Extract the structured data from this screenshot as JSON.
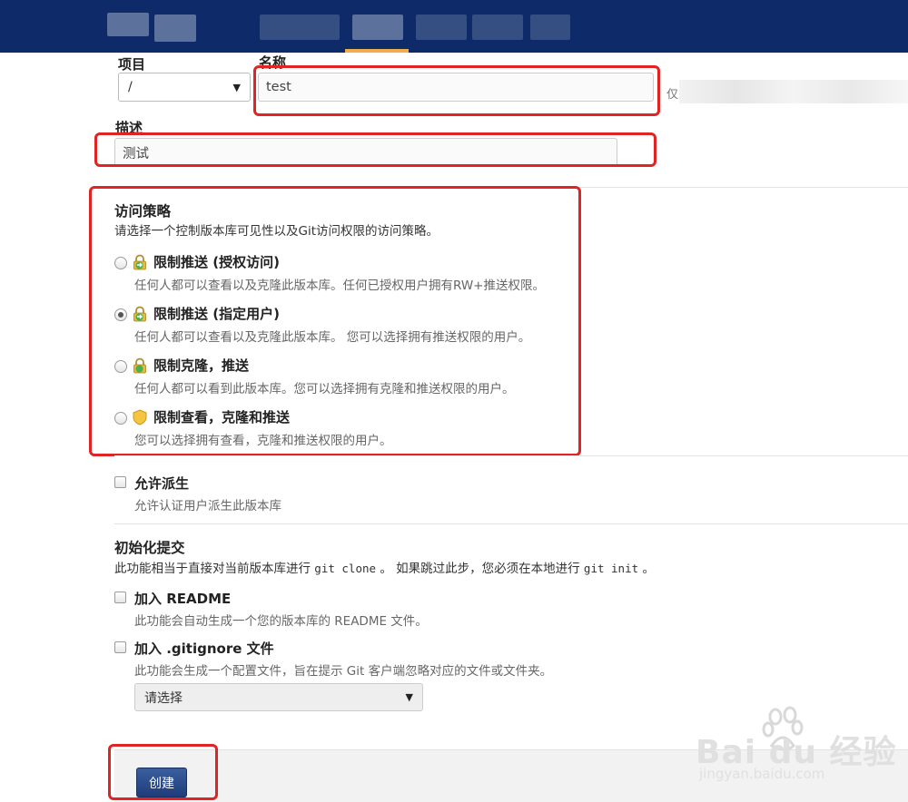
{
  "form": {
    "project_label": "项目",
    "project_value": "/",
    "name_label": "名称",
    "name_value": "test",
    "name_side_hint": "仅",
    "description_label": "描述",
    "description_value": "测试"
  },
  "access": {
    "title": "访问策略",
    "description": "请选择一个控制版本库可见性以及Git访问权限的访问策略。",
    "options": [
      {
        "label": "限制推送 (授权访问)",
        "help": "任何人都可以查看以及克隆此版本库。任何已授权用户拥有RW+推送权限。",
        "checked": false,
        "icon": "lock-green-arrow-icon"
      },
      {
        "label": "限制推送 (指定用户)",
        "help": "任何人都可以查看以及克隆此版本库。 您可以选择拥有推送权限的用户。",
        "checked": true,
        "icon": "lock-green-arrow-icon"
      },
      {
        "label": "限制克隆，推送",
        "help": "任何人都可以看到此版本库。您可以选择拥有克隆和推送权限的用户。",
        "checked": false,
        "icon": "lock-green-icon"
      },
      {
        "label": "限制查看，克隆和推送",
        "help": "您可以选择拥有查看，克隆和推送权限的用户。",
        "checked": false,
        "icon": "shield-icon"
      }
    ]
  },
  "fork": {
    "label": "允许派生",
    "help": "允许认证用户派生此版本库"
  },
  "init": {
    "title": "初始化提交",
    "desc_part1": "此功能相当于直接对当前版本库进行",
    "desc_code1": "git clone",
    "desc_part2": "。 如果跳过此步，您必须在本地进行",
    "desc_code2": "git init",
    "desc_part3": "。",
    "readme_label": "加入 README",
    "readme_help": "此功能会自动生成一个您的版本库的 README 文件。",
    "gitignore_label": "加入 .gitignore 文件",
    "gitignore_help": "此功能会生成一个配置文件，旨在提示 Git 客户端忽略对应的文件或文件夹。",
    "gitignore_select": "请选择"
  },
  "create_label": "创建",
  "watermark": {
    "logo": "Bai du 经验",
    "url": "jingyan.baidu.com"
  },
  "colors": {
    "nav_bg": "#0f2a68",
    "nav_active": "#f0ad4e",
    "annotation_red": "#e02424",
    "button_blue": "#1f3c7a"
  }
}
